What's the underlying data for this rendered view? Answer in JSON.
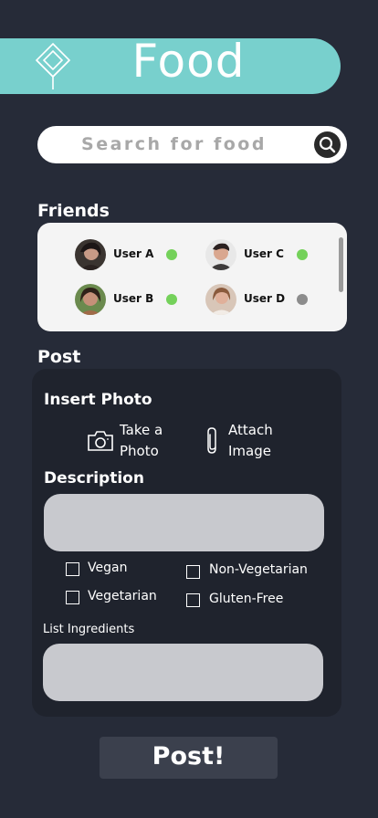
{
  "header": {
    "title": "Food",
    "logo_icon": "diamond-leaf-icon",
    "color": "#78d0cd"
  },
  "search": {
    "placeholder": "Search for food",
    "icon": "search-icon"
  },
  "friends": {
    "title": "Friends",
    "users": [
      {
        "name": "User A",
        "status": "online",
        "status_color": "#74d15a"
      },
      {
        "name": "User C",
        "status": "online",
        "status_color": "#74d15a"
      },
      {
        "name": "User B",
        "status": "online",
        "status_color": "#74d15a"
      },
      {
        "name": "User D",
        "status": "offline",
        "status_color": "#8c8c8c"
      }
    ]
  },
  "post": {
    "title": "Post",
    "insert_photo": {
      "title": "Insert Photo",
      "take_photo_line1": "Take a",
      "take_photo_line2": "Photo",
      "attach_line1": "Attach",
      "attach_line2": "Image"
    },
    "description": {
      "title": "Description",
      "value": ""
    },
    "options": [
      "Vegan",
      "Non-Vegetarian",
      "Vegetarian",
      "Gluten-Free"
    ],
    "ingredients": {
      "label": "List Ingredients",
      "value": ""
    },
    "submit_label": "Post!"
  }
}
